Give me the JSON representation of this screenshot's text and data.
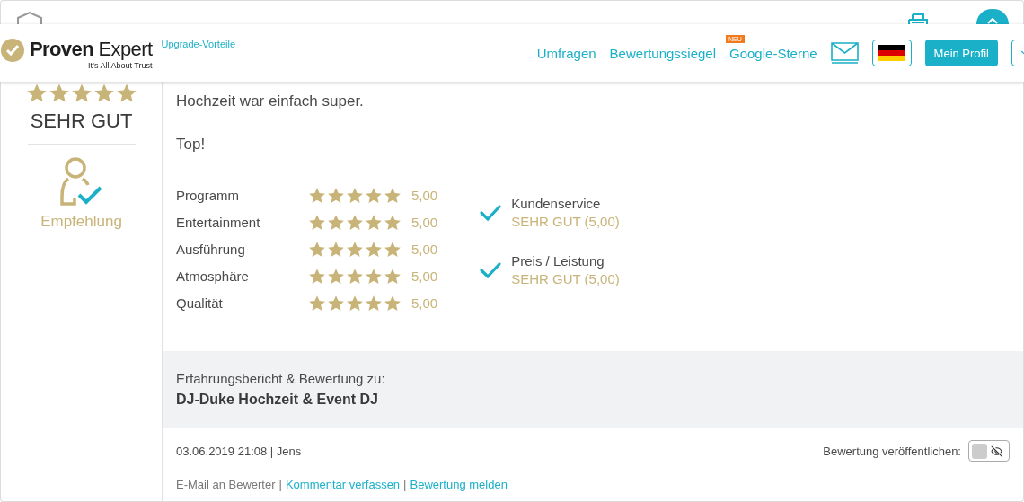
{
  "header": {
    "logo": {
      "brand_bold": "Proven",
      "brand_light": "Expert",
      "tagline": "It’s All About Trust"
    },
    "upgrade_link": "Upgrade-Vorteile",
    "nav": [
      {
        "label": "Umfragen"
      },
      {
        "label": "Bewertungssiegel"
      },
      {
        "label": "Google-Sterne",
        "badge": "NEU"
      }
    ],
    "profile_button": "Mein Profil"
  },
  "summary": {
    "stars": 5,
    "verdict": "SEHR GUT",
    "recommendation": "Empfehlung"
  },
  "paragraphs": [
    "Hochzeit war einfach super.",
    "Top!"
  ],
  "ratings": [
    {
      "label": "Programm",
      "stars": 5,
      "value": "5,00"
    },
    {
      "label": "Entertainment",
      "stars": 5,
      "value": "5,00"
    },
    {
      "label": "Ausführung",
      "stars": 5,
      "value": "5,00"
    },
    {
      "label": "Atmosphäre",
      "stars": 5,
      "value": "5,00"
    },
    {
      "label": "Qualität",
      "stars": 5,
      "value": "5,00"
    }
  ],
  "criteria": [
    {
      "label": "Kundenservice",
      "verdict": "SEHR GUT (5,00)"
    },
    {
      "label": "Preis / Leistung",
      "verdict": "SEHR GUT (5,00)"
    }
  ],
  "subject": {
    "label": "Erfahrungsbericht & Bewertung zu:",
    "company": "DJ-Duke Hochzeit & Event DJ"
  },
  "meta": "03.06.2019 21:08 | Jens",
  "publish": {
    "label": "Bewertung veröffentlichen:",
    "on": false
  },
  "separator": "|",
  "actions": [
    {
      "label": "E-Mail an Bewerter",
      "kind": "text"
    },
    {
      "label": "Kommentar verfassen",
      "kind": "link"
    },
    {
      "label": "Bewertung melden",
      "kind": "link"
    }
  ]
}
